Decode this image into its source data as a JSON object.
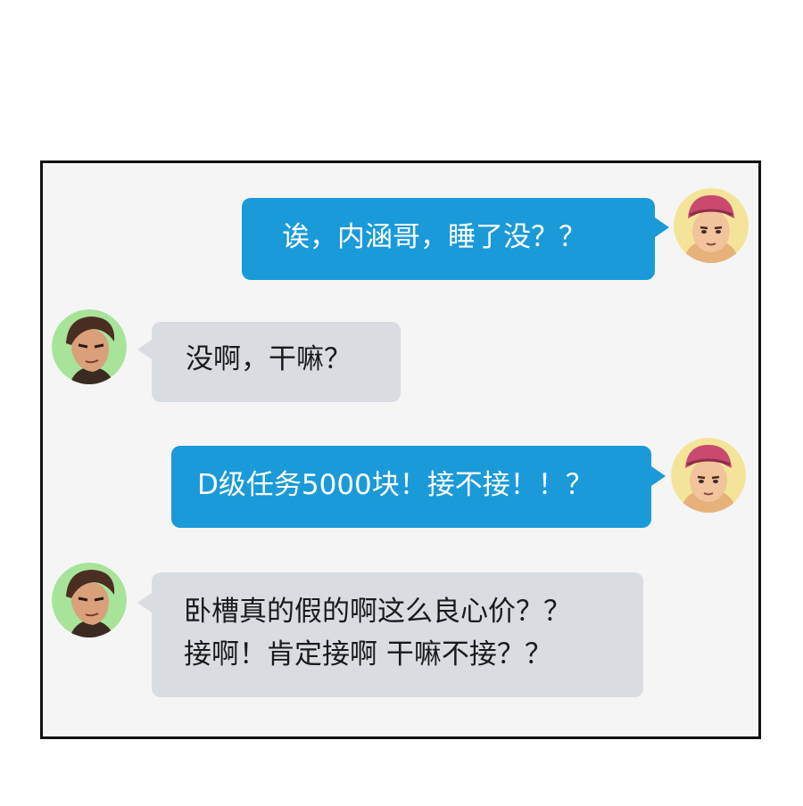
{
  "colors": {
    "outgoing_bubble": "#1a9ad9",
    "incoming_bubble": "#d9dde2",
    "outgoing_text": "#ffffff",
    "incoming_text": "#1a1a1a",
    "panel_background": "#f5f5f5",
    "panel_border": "#111111"
  },
  "chat": {
    "messages": [
      {
        "sender": "pink-hair-friend",
        "direction": "outgoing",
        "avatar_icon": "pink-hair-man-avatar-icon",
        "lines": [
          "诶，内涵哥，睡了没？？"
        ]
      },
      {
        "sender": "neihan-ge",
        "direction": "incoming",
        "avatar_icon": "brown-hair-man-avatar-icon",
        "lines": [
          "没啊，干嘛？"
        ]
      },
      {
        "sender": "pink-hair-friend",
        "direction": "outgoing",
        "avatar_icon": "pink-hair-man-avatar-icon",
        "lines": [
          "D级任务5000块！接不接！！？"
        ]
      },
      {
        "sender": "neihan-ge",
        "direction": "incoming",
        "avatar_icon": "brown-hair-man-avatar-icon",
        "lines": [
          "卧槽真的假的啊这么良心价？？",
          "接啊！肯定接啊 干嘛不接？？"
        ]
      }
    ]
  }
}
